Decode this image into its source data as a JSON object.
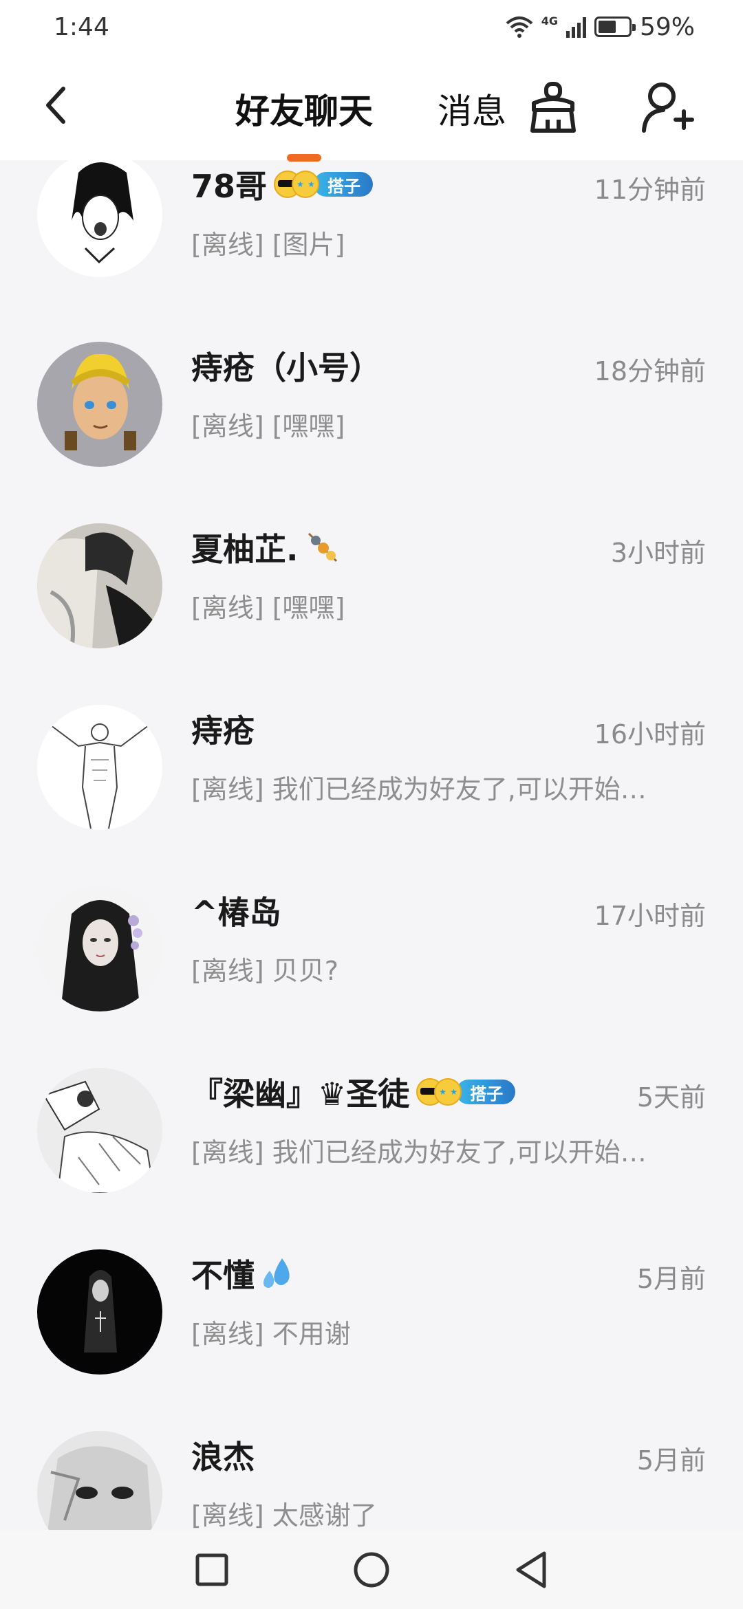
{
  "status_bar": {
    "time": "1:44",
    "network_tag": "4G",
    "battery_text": "59%",
    "battery_level": 0.59
  },
  "header": {
    "tab_friends": "好友聊天",
    "tab_messages": "消息"
  },
  "badge": {
    "tag_label": "搭子"
  },
  "chats": [
    {
      "name": "78哥",
      "time": "11分钟前",
      "preview": "[离线] [图片]",
      "badge": true
    },
    {
      "name": "痔疮（小号）",
      "time": "18分钟前",
      "preview": "[离线] [嘿嘿]",
      "badge": false
    },
    {
      "name": "夏柚芷.",
      "time": "3小时前",
      "preview": "[离线] [嘿嘿]",
      "badge": false
    },
    {
      "name": "痔疮",
      "time": "16小时前",
      "preview": "[离线] 我们已经成为好友了,可以开始…",
      "badge": false
    },
    {
      "name": "^椿岛",
      "time": "17小时前",
      "preview": "[离线] 贝贝?",
      "badge": false
    },
    {
      "name": "『梁幽』♛圣徒",
      "time": "5天前",
      "preview": "[离线] 我们已经成为好友了,可以开始…",
      "badge": true
    },
    {
      "name": "不懂",
      "time": "5月前",
      "preview": "[离线] 不用谢",
      "badge": false
    },
    {
      "name": "浪杰",
      "time": "5月前",
      "preview": "[离线] 太感谢了",
      "badge": false
    }
  ],
  "colors": {
    "accent": "#f06a23",
    "tag_start": "#3ab5e8",
    "tag_end": "#2a78c8"
  }
}
